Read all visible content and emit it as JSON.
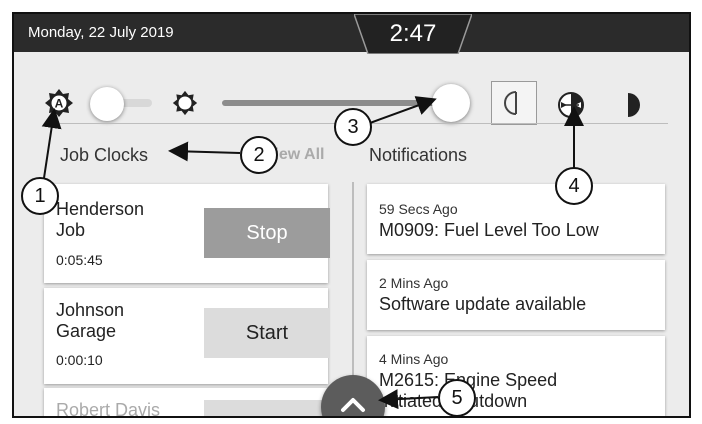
{
  "status_bar": {
    "date": "Monday, 22 July 2019",
    "time": "2:47"
  },
  "controls": {
    "auto_brightness_icon": "auto-brightness-icon",
    "brightness_icon": "brightness-icon",
    "auto_brightness_enabled": false,
    "brightness_level": 0.95,
    "display_modes": [
      "day-mode-icon",
      "auto-mode-icon",
      "night-mode-icon"
    ],
    "selected_mode": "day-mode-icon"
  },
  "job_clocks": {
    "title": "Job Clocks",
    "view_all": "View All",
    "items": [
      {
        "name_line1": "Henderson",
        "name_line2": "Job",
        "elapsed": "0:05:45",
        "action": "Stop"
      },
      {
        "name_line1": "Johnson",
        "name_line2": "Garage",
        "elapsed": "0:00:10",
        "action": "Start"
      },
      {
        "name_line1": "Robert Davis",
        "name_line2": "",
        "elapsed": "",
        "action": ""
      }
    ]
  },
  "notifications": {
    "title": "Notifications",
    "items": [
      {
        "ago": "59 Secs Ago",
        "message": "M0909: Fuel Level Too Low",
        "message_line2": ""
      },
      {
        "ago": "2 Mins Ago",
        "message": "Software update available",
        "message_line2": ""
      },
      {
        "ago": "4 Mins Ago",
        "message": "M2615: Engine Speed",
        "message_line2": "Initiated Shutdown"
      }
    ]
  },
  "expand_button": {
    "icon": "chevron-up-icon"
  },
  "callouts": [
    "1",
    "2",
    "3",
    "4",
    "5"
  ]
}
